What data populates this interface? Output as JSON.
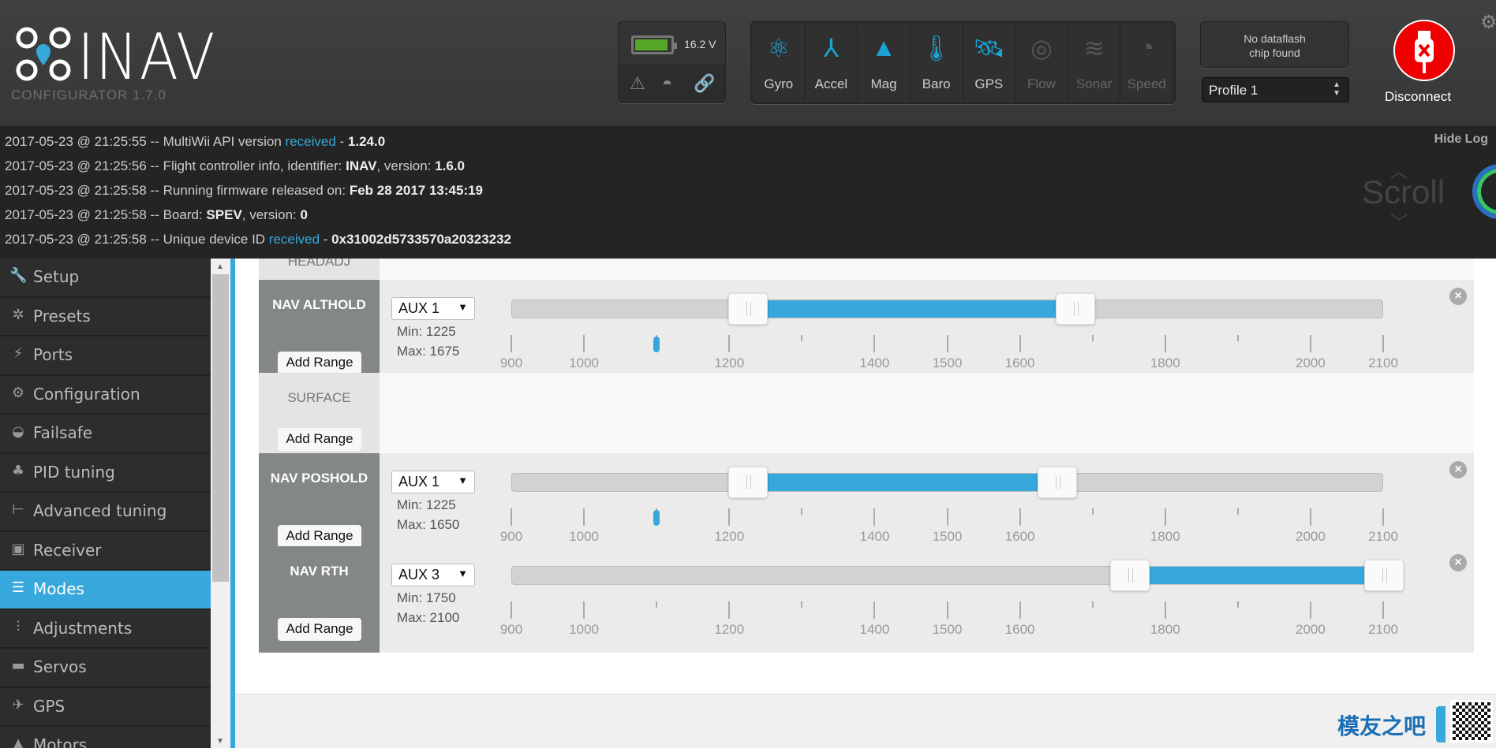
{
  "app": {
    "title": "INAV",
    "subtitle": "CONFIGURATOR  1.7.0"
  },
  "battery": {
    "voltage": "16.2 V",
    "level": 0.9,
    "color": "#56a526"
  },
  "status_icons": [
    "warning-icon",
    "failsafe-parachute-icon",
    "link-icon"
  ],
  "sensors": [
    {
      "label": "Gyro",
      "icon": "gyro-icon",
      "active": true
    },
    {
      "label": "Accel",
      "icon": "accel-icon",
      "active": true
    },
    {
      "label": "Mag",
      "icon": "mag-icon",
      "active": true
    },
    {
      "label": "Baro",
      "icon": "baro-icon",
      "active": true
    },
    {
      "label": "GPS",
      "icon": "gps-icon",
      "active": true
    },
    {
      "label": "Flow",
      "icon": "flow-icon",
      "active": false
    },
    {
      "label": "Sonar",
      "icon": "sonar-icon",
      "active": false
    },
    {
      "label": "Speed",
      "icon": "speed-icon",
      "active": false
    }
  ],
  "dataflash": {
    "line1": "No dataflash",
    "line2": "chip found"
  },
  "profile": {
    "selected": "Profile 1"
  },
  "disconnect": {
    "label": "Disconnect",
    "color": "#e00000"
  },
  "log": {
    "hide_label": "Hide Log",
    "scroll_label": "Scroll",
    "lines": [
      {
        "prefix": "2017-05-23 @ 21:25:55 -- MultiWii API version ",
        "link": "received",
        "mid": " - ",
        "bold": "1.24.0",
        "suffix": ""
      },
      {
        "prefix": "2017-05-23 @ 21:25:56 -- Flight controller info, identifier: ",
        "link": "",
        "mid": "",
        "bold": "INAV",
        "suffix": ", version: ",
        "bold2": "1.6.0"
      },
      {
        "prefix": "2017-05-23 @ 21:25:58 -- Running firmware released on: ",
        "link": "",
        "mid": "",
        "bold": "Feb 28 2017 13:45:19",
        "suffix": ""
      },
      {
        "prefix": "2017-05-23 @ 21:25:58 -- Board: ",
        "link": "",
        "mid": "",
        "bold": "SPEV",
        "suffix": ", version: ",
        "bold2": "0"
      },
      {
        "prefix": "2017-05-23 @ 21:25:58 -- Unique device ID ",
        "link": "received",
        "mid": " - ",
        "bold": "0x31002d5733570a20323232",
        "suffix": ""
      }
    ]
  },
  "sidebar": {
    "items": [
      {
        "label": "Setup",
        "icon": "wrench-icon",
        "glyph": "🔧"
      },
      {
        "label": "Presets",
        "icon": "magic-wand-icon",
        "glyph": "✲"
      },
      {
        "label": "Ports",
        "icon": "plug-icon",
        "glyph": "⚡"
      },
      {
        "label": "Configuration",
        "icon": "gear-icon",
        "glyph": "⚙"
      },
      {
        "label": "Failsafe",
        "icon": "parachute-icon",
        "glyph": "◒"
      },
      {
        "label": "PID tuning",
        "icon": "pid-tree-icon",
        "glyph": "♣"
      },
      {
        "label": "Advanced tuning",
        "icon": "advanced-tree-icon",
        "glyph": "⊢"
      },
      {
        "label": "Receiver",
        "icon": "receiver-icon",
        "glyph": "▣"
      },
      {
        "label": "Modes",
        "icon": "toggles-icon",
        "glyph": "☰",
        "active": true
      },
      {
        "label": "Adjustments",
        "icon": "sliders-icon",
        "glyph": "⫶"
      },
      {
        "label": "Servos",
        "icon": "servo-icon",
        "glyph": "▬"
      },
      {
        "label": "GPS",
        "icon": "satellite-icon",
        "glyph": "✈"
      },
      {
        "label": "Motors",
        "icon": "motor-icon",
        "glyph": "▲"
      }
    ]
  },
  "modes": {
    "add_range_label": "Add Range",
    "min_prefix": "Min: ",
    "max_prefix": "Max: ",
    "scale": {
      "min": 900,
      "max": 2100,
      "labels": [
        900,
        1000,
        1200,
        1400,
        1500,
        1600,
        1800,
        2000,
        2100
      ]
    },
    "panels": [
      {
        "name": "HEADADJ",
        "active": false
      },
      {
        "name": "NAV ALTHOLD",
        "active": true,
        "channel": "AUX 1",
        "min": 1225,
        "max": 1675,
        "current": 1100
      },
      {
        "name": "SURFACE",
        "active": false
      },
      {
        "name": "NAV POSHOLD",
        "active": true,
        "channel": "AUX 1",
        "min": 1225,
        "max": 1650,
        "current": 1100
      },
      {
        "name": "NAV RTH",
        "active": true,
        "channel": "AUX 3",
        "min": 1750,
        "max": 2100
      }
    ]
  },
  "watermark": {
    "text": "模友之吧",
    "url": "http://www.moz8.com"
  }
}
